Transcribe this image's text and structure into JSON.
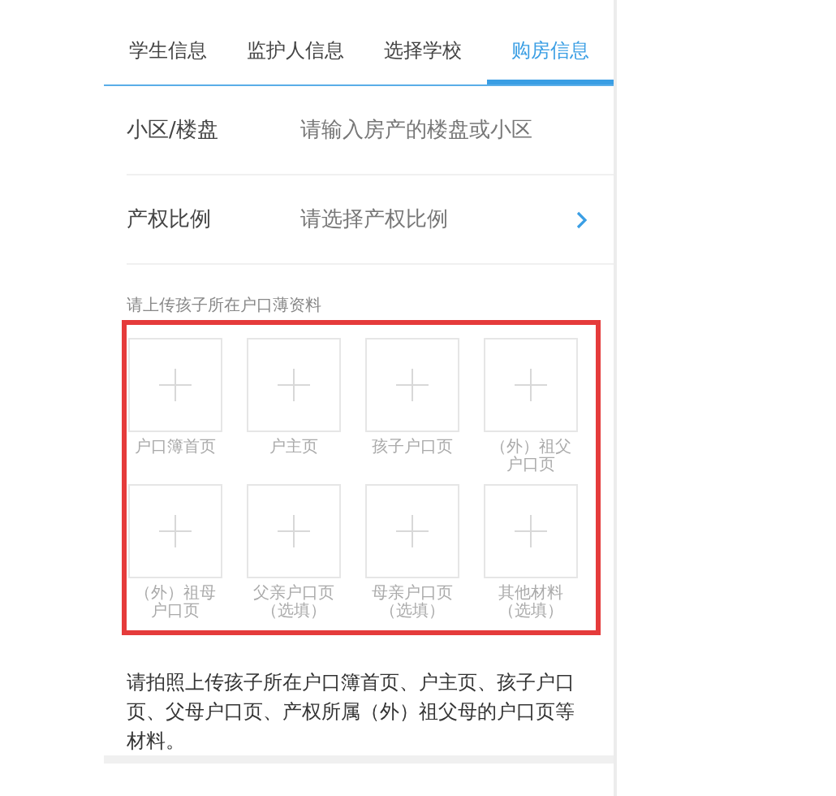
{
  "tabs": [
    {
      "label": "学生信息",
      "selected": false
    },
    {
      "label": "监护人信息",
      "selected": false
    },
    {
      "label": "选择学校",
      "selected": false
    },
    {
      "label": "购房信息",
      "selected": true
    }
  ],
  "form_rows": [
    {
      "label": "小区/楼盘",
      "placeholder": "请输入房产的楼盘或小区",
      "kind": "input"
    },
    {
      "label": "产权比例",
      "placeholder": "请选择产权比例",
      "kind": "select"
    }
  ],
  "upload_hint": "请上传孩子所在户口薄资料",
  "upload_slots": [
    {
      "label": "户口簿首页"
    },
    {
      "label": "户主页"
    },
    {
      "label": "孩子户口页"
    },
    {
      "label": "（外）祖父户口页"
    },
    {
      "label": "（外）祖母户口页"
    },
    {
      "label": "父亲户口页（选填）"
    },
    {
      "label": "母亲户口页（选填）"
    },
    {
      "label": "其他材料（选填）"
    }
  ],
  "instructions": "请拍照上传孩子所在户口簿首页、户主页、孩子户口页、父母户口页、产权所属（外）祖父母的户口页等材料。"
}
